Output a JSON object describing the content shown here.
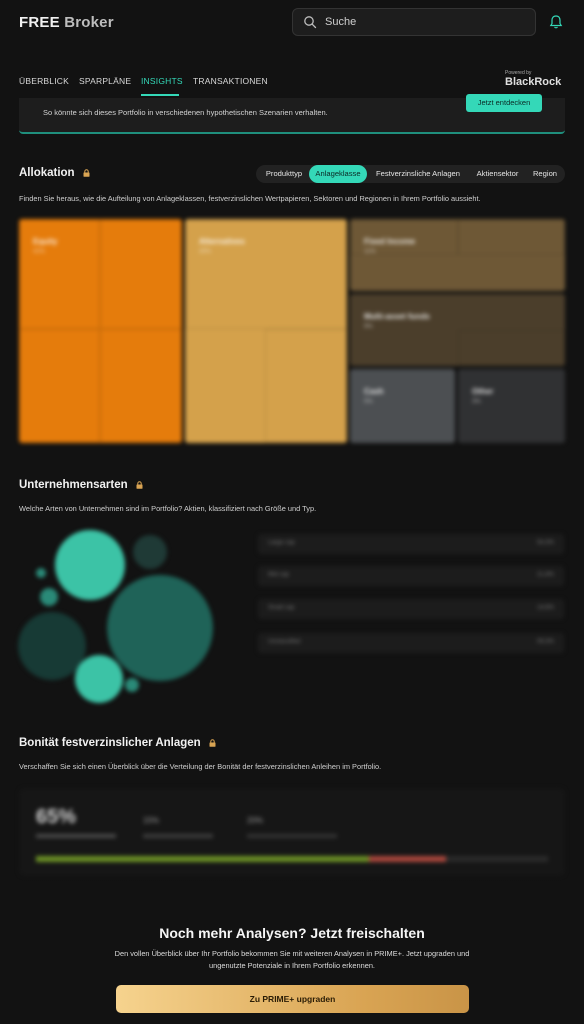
{
  "header": {
    "logo_bold": "FREE",
    "logo_light": "Broker",
    "search_placeholder": "Suche"
  },
  "nav": {
    "tabs": [
      {
        "label": "ÜBERBLICK"
      },
      {
        "label": "SPARPLÄNE"
      },
      {
        "label": "INSIGHTS",
        "active": true
      },
      {
        "label": "TRANSAKTIONEN"
      }
    ],
    "powered_by": "Powered by",
    "partner": "BlackRock"
  },
  "banner": {
    "text": "So könnte sich dieses Portfolio in verschiedenen hypothetischen Szenarien verhalten.",
    "button": "Jetzt entdecken"
  },
  "allocation": {
    "title": "Allokation",
    "description": "Finden Sie heraus, wie die Aufteilung von Anlageklassen, festverzinslichen Wertpapieren, Sektoren und Regionen in Ihrem Portfolio aussieht.",
    "chips": [
      {
        "label": "Produkttyp"
      },
      {
        "label": "Anlageklasse",
        "active": true
      },
      {
        "label": "Festverzinsliche Anlagen"
      },
      {
        "label": "Aktiensektor"
      },
      {
        "label": "Region"
      }
    ],
    "treemap": [
      {
        "label": "Equity",
        "pct": "42%",
        "color": "#e57c0c"
      },
      {
        "label": "Alternatives",
        "pct": "30%",
        "color": "#d4a14b"
      },
      {
        "label": "Fixed Income",
        "pct": "11%",
        "color": "#6e5836"
      },
      {
        "label": "Multi-asset funds",
        "pct": "9%",
        "color": "#4b3e2b"
      },
      {
        "label": "Cash",
        "pct": "5%",
        "color": "#4c4f52"
      },
      {
        "label": "Other",
        "pct": "3%",
        "color": "#303133"
      }
    ]
  },
  "companies": {
    "title": "Unternehmensarten",
    "description": "Welche Arten von Unternehmen sind im Portfolio? Aktien, klassifiziert nach Größe und Typ.",
    "rows": [
      {
        "label": "Large cap",
        "value": "54,3%"
      },
      {
        "label": "Mid cap",
        "value": "21,8%"
      },
      {
        "label": "Small cap",
        "value": "14,6%"
      },
      {
        "label": "Unclassified",
        "value": "09,3%"
      }
    ],
    "bubble_colors": [
      "#3cc3a6",
      "#1f5f55",
      "#173a35",
      "#2a8a78"
    ]
  },
  "credit": {
    "title": "Bonität festverzinslicher Anlagen",
    "description": "Verschaffen Sie sich einen Überblick über die Verteilung der Bonität der festverzinslichen Anleihen im Portfolio.",
    "big_value": "65%",
    "values": [
      "15%",
      "20%"
    ],
    "bar": [
      {
        "fraction": 0.65,
        "color": "#6a8f25"
      },
      {
        "fraction": 0.15,
        "color": "#a9463c"
      },
      {
        "fraction": 0.2,
        "color": "#2a2a2a"
      }
    ]
  },
  "upsell": {
    "title": "Noch mehr Analysen? Jetzt freischalten",
    "text": "Den vollen Überblick über Ihr Portfolio bekommen Sie mit weiteren Analysen in PRIME+. Jetzt upgraden und ungenutzte Potenziale in Ihrem Portfolio erkennen.",
    "button": "Zu PRIME+ upgraden"
  }
}
